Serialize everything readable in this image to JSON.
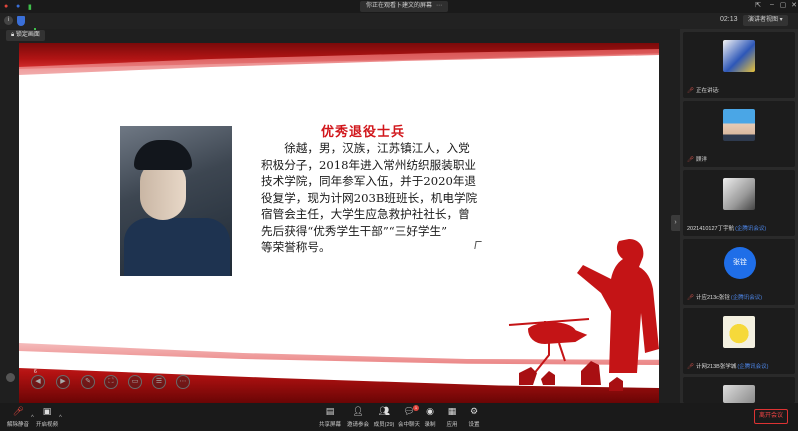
{
  "titlebar": {
    "title": "你正在观看卜建文的屏幕"
  },
  "toolbar": {
    "time": "02:13",
    "view_label": "演讲者视图"
  },
  "lock_view": {
    "label": "锁定画面"
  },
  "slide": {
    "title": "优秀退役士兵",
    "lines": [
      "　　徐越，男，汉族，江苏镇江人，入党",
      "积极分子，2018年进入常州纺织服装职业",
      "技术学院，同年参军入伍，并于2020年退",
      "役复学，现为计网203B班班长，机电学院",
      "宿管会主任，大学生应急救护社社长，曾",
      "先后获得“优秀学生干部”“三好学生”",
      "等荣誉称号。"
    ],
    "page_indicator": "6"
  },
  "participants": [
    {
      "name": "正在讲话:",
      "tag": "",
      "avatar_color": "#f0f0f0",
      "avatar_text": ""
    },
    {
      "name": "顾洋",
      "tag": "",
      "avatar_color": "#3a9be0",
      "avatar_text": ""
    },
    {
      "name": "2021410127丁宇航",
      "tag": "(企腾讯会议)",
      "avatar_color": "#d9d9d9",
      "avatar_text": ""
    },
    {
      "name": "计应213c张铨",
      "tag": "(企腾讯会议)",
      "avatar_color": "#1f6ee8",
      "avatar_text": "张铨"
    },
    {
      "name": "计网213B张学城",
      "tag": "(企腾讯会议)",
      "avatar_color": "#f2e6a0",
      "avatar_text": ""
    },
    {
      "name": "",
      "tag": "",
      "avatar_color": "#cfcfcf",
      "avatar_text": ""
    }
  ],
  "bottombar": {
    "left": [
      {
        "label": "解除静音"
      },
      {
        "label": "开启视频"
      }
    ],
    "center": [
      {
        "label": "共享屏幕"
      },
      {
        "label": "邀请参会"
      },
      {
        "label": "成员(29)"
      },
      {
        "label": "会中聊天",
        "badge": "1"
      },
      {
        "label": "录制"
      },
      {
        "label": "应用"
      },
      {
        "label": "设置"
      }
    ],
    "leave_label": "离开会议"
  },
  "colors": {
    "accent_red": "#d1161b",
    "meeting_blue": "#1f6ee8",
    "leave_red": "#e44444"
  }
}
